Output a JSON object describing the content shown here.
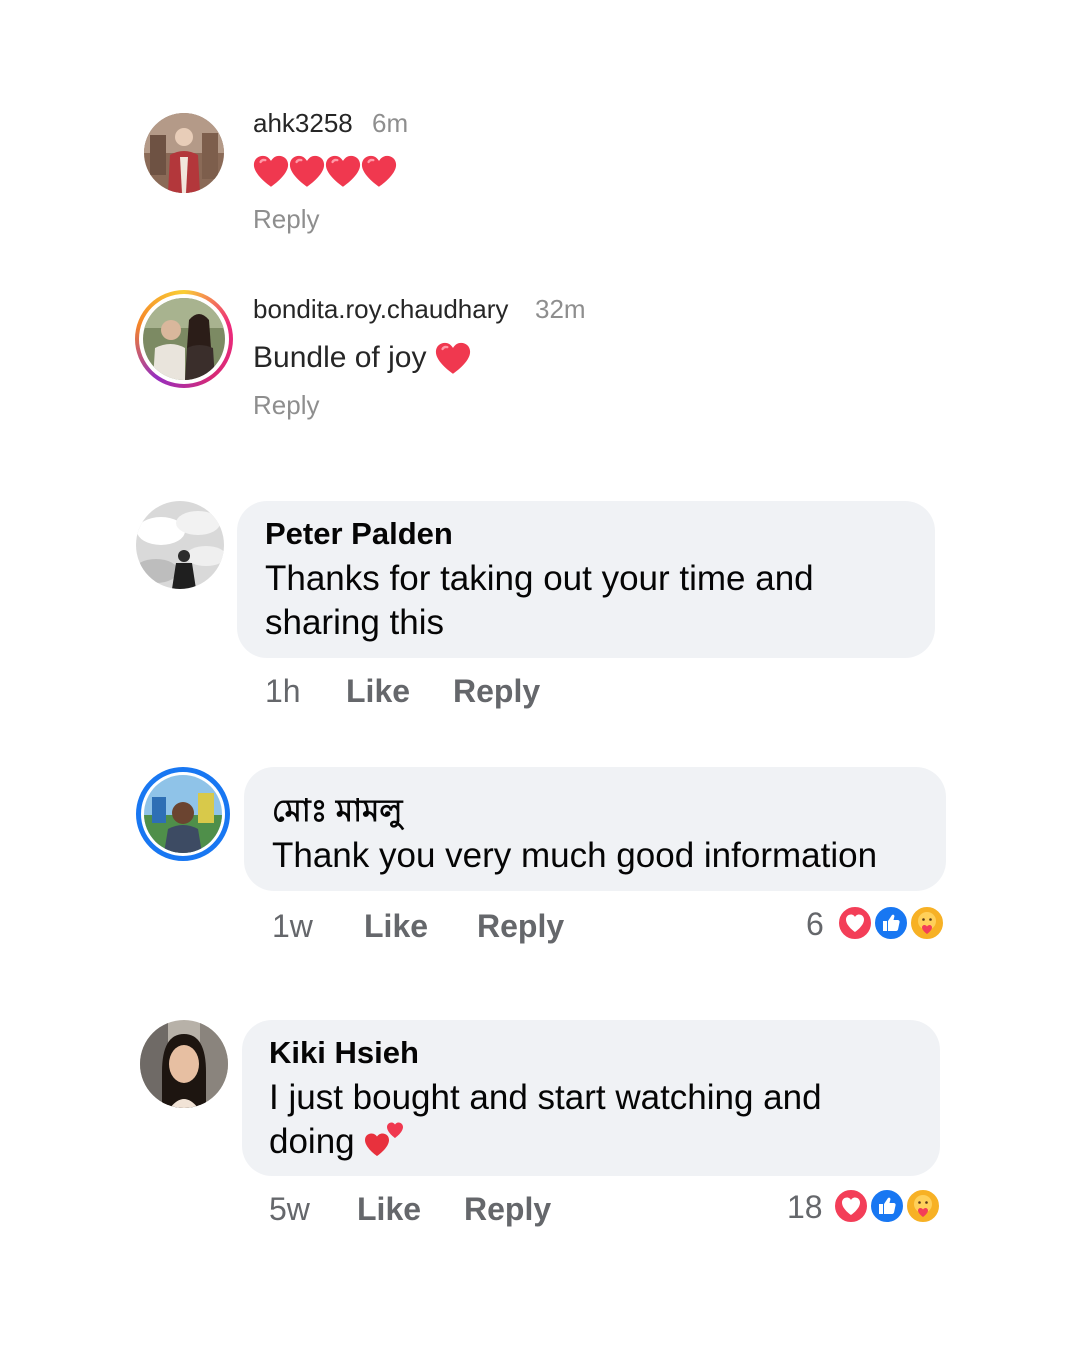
{
  "comments": [
    {
      "username": "ahk3258",
      "time": "6m",
      "text": "",
      "emoji": [
        "red-heart",
        "red-heart",
        "red-heart",
        "red-heart"
      ],
      "reply_label": "Reply"
    },
    {
      "username": "bondita.roy.chaudhary",
      "time": "32m",
      "text": "Bundle of joy",
      "emoji": [
        "red-heart"
      ],
      "reply_label": "Reply"
    },
    {
      "name": "Peter Palden",
      "text_line1": "Thanks for taking out your time and",
      "text_line2": "sharing this",
      "time": "1h",
      "like_label": "Like",
      "reply_label": "Reply"
    },
    {
      "name": "মোঃ মামলু",
      "text_line1": "Thank you very much good information",
      "time": "1w",
      "like_label": "Like",
      "reply_label": "Reply",
      "reaction_count": "6",
      "reactions": [
        "love",
        "like",
        "care"
      ]
    },
    {
      "name": "Kiki Hsieh",
      "text_line1": "I just bought and start watching and",
      "text_line2": "doing",
      "emoji": [
        "two-hearts"
      ],
      "time": "5w",
      "like_label": "Like",
      "reply_label": "Reply",
      "reaction_count": "18",
      "reactions": [
        "love",
        "like",
        "care"
      ]
    }
  ],
  "colors": {
    "fb_blue": "#1877f2",
    "love_red": "#f33e58",
    "bubble_bg": "#f0f2f5",
    "muted_text": "#65676b",
    "ig_muted": "#8e8e8e"
  }
}
